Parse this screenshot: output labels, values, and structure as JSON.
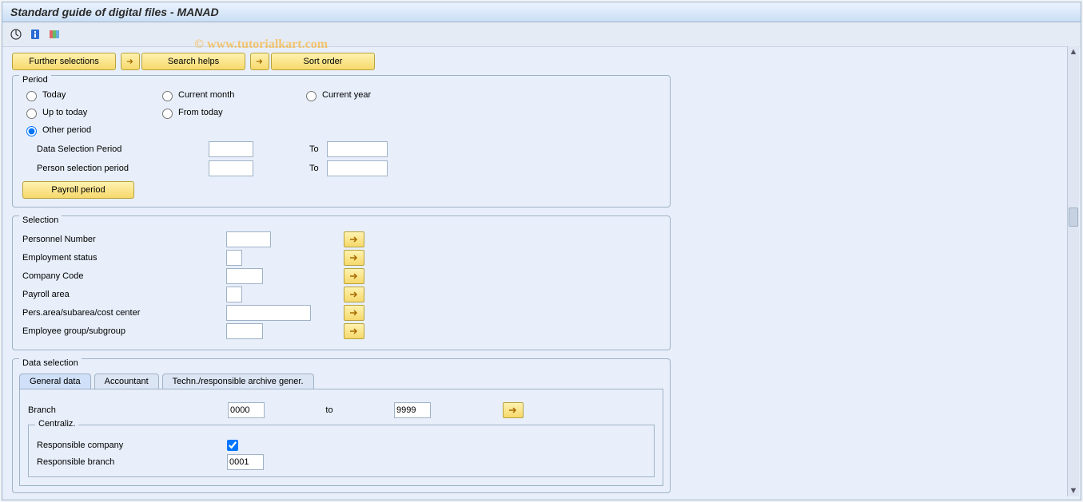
{
  "window": {
    "title": "Standard guide of digital files - MANAD"
  },
  "watermark": "© www.tutorialkart.com",
  "toolbar": {
    "execute_icon": "execute",
    "info_icon": "info",
    "layout_icon": "layout"
  },
  "top_buttons": {
    "further_selections": "Further selections",
    "search_helps": "Search helps",
    "sort_order": "Sort order"
  },
  "period": {
    "legend": "Period",
    "radios": {
      "today": "Today",
      "current_month": "Current month",
      "current_year": "Current year",
      "up_to_today": "Up to today",
      "from_today": "From today",
      "other_period": "Other period"
    },
    "selected": "other_period",
    "data_selection_label": "Data Selection Period",
    "data_selection_from": "",
    "data_selection_to": "",
    "person_selection_label": "Person selection period",
    "person_selection_from": "",
    "person_selection_to": "",
    "to_label": "To",
    "payroll_period_btn": "Payroll period"
  },
  "selection": {
    "legend": "Selection",
    "rows": {
      "pernr": {
        "label": "Personnel Number",
        "value": ""
      },
      "empstat": {
        "label": "Employment status",
        "value": ""
      },
      "company": {
        "label": "Company Code",
        "value": ""
      },
      "payroll_area": {
        "label": "Payroll area",
        "value": ""
      },
      "pers_area": {
        "label": "Pers.area/subarea/cost center",
        "value": ""
      },
      "emp_group": {
        "label": "Employee group/subgroup",
        "value": ""
      }
    }
  },
  "data_selection": {
    "legend": "Data selection",
    "tabs": {
      "general": "General data",
      "accountant": "Accountant",
      "techn": "Techn./responsible archive gener."
    },
    "active_tab": "general",
    "general": {
      "branch_label": "Branch",
      "branch_from": "0000",
      "to_label": "to",
      "branch_to": "9999",
      "centraliz_legend": "Centraliz.",
      "resp_company_label": "Responsible company",
      "resp_company_checked": true,
      "resp_branch_label": "Responsible branch",
      "resp_branch_value": "0001"
    }
  }
}
